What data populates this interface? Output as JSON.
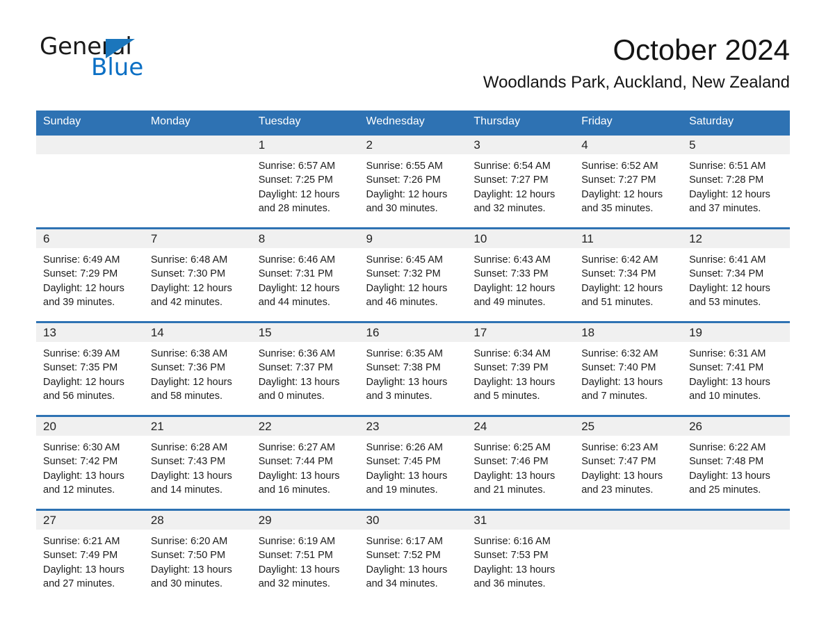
{
  "brand": {
    "name_part1": "General",
    "name_part2": "Blue",
    "triangle_icon": "triangle-logo-icon",
    "accent_color": "#1b76bc"
  },
  "header": {
    "month_title": "October 2024",
    "location": "Woodlands Park, Auckland, New Zealand"
  },
  "theme": {
    "header_blue": "#2e72b3",
    "daynum_band_gray": "#f0f0f0",
    "cell_background": "#ffffff",
    "text_color": "#1c1c1c"
  },
  "calendar": {
    "weekday_headers": [
      "Sunday",
      "Monday",
      "Tuesday",
      "Wednesday",
      "Thursday",
      "Friday",
      "Saturday"
    ],
    "weeks": [
      [
        {
          "day": "",
          "empty": true
        },
        {
          "day": "",
          "empty": true
        },
        {
          "day": "1",
          "sunrise": "Sunrise: 6:57 AM",
          "sunset": "Sunset: 7:25 PM",
          "daylight_line1": "Daylight: 12 hours",
          "daylight_line2": "and 28 minutes."
        },
        {
          "day": "2",
          "sunrise": "Sunrise: 6:55 AM",
          "sunset": "Sunset: 7:26 PM",
          "daylight_line1": "Daylight: 12 hours",
          "daylight_line2": "and 30 minutes."
        },
        {
          "day": "3",
          "sunrise": "Sunrise: 6:54 AM",
          "sunset": "Sunset: 7:27 PM",
          "daylight_line1": "Daylight: 12 hours",
          "daylight_line2": "and 32 minutes."
        },
        {
          "day": "4",
          "sunrise": "Sunrise: 6:52 AM",
          "sunset": "Sunset: 7:27 PM",
          "daylight_line1": "Daylight: 12 hours",
          "daylight_line2": "and 35 minutes."
        },
        {
          "day": "5",
          "sunrise": "Sunrise: 6:51 AM",
          "sunset": "Sunset: 7:28 PM",
          "daylight_line1": "Daylight: 12 hours",
          "daylight_line2": "and 37 minutes."
        }
      ],
      [
        {
          "day": "6",
          "sunrise": "Sunrise: 6:49 AM",
          "sunset": "Sunset: 7:29 PM",
          "daylight_line1": "Daylight: 12 hours",
          "daylight_line2": "and 39 minutes."
        },
        {
          "day": "7",
          "sunrise": "Sunrise: 6:48 AM",
          "sunset": "Sunset: 7:30 PM",
          "daylight_line1": "Daylight: 12 hours",
          "daylight_line2": "and 42 minutes."
        },
        {
          "day": "8",
          "sunrise": "Sunrise: 6:46 AM",
          "sunset": "Sunset: 7:31 PM",
          "daylight_line1": "Daylight: 12 hours",
          "daylight_line2": "and 44 minutes."
        },
        {
          "day": "9",
          "sunrise": "Sunrise: 6:45 AM",
          "sunset": "Sunset: 7:32 PM",
          "daylight_line1": "Daylight: 12 hours",
          "daylight_line2": "and 46 minutes."
        },
        {
          "day": "10",
          "sunrise": "Sunrise: 6:43 AM",
          "sunset": "Sunset: 7:33 PM",
          "daylight_line1": "Daylight: 12 hours",
          "daylight_line2": "and 49 minutes."
        },
        {
          "day": "11",
          "sunrise": "Sunrise: 6:42 AM",
          "sunset": "Sunset: 7:34 PM",
          "daylight_line1": "Daylight: 12 hours",
          "daylight_line2": "and 51 minutes."
        },
        {
          "day": "12",
          "sunrise": "Sunrise: 6:41 AM",
          "sunset": "Sunset: 7:34 PM",
          "daylight_line1": "Daylight: 12 hours",
          "daylight_line2": "and 53 minutes."
        }
      ],
      [
        {
          "day": "13",
          "sunrise": "Sunrise: 6:39 AM",
          "sunset": "Sunset: 7:35 PM",
          "daylight_line1": "Daylight: 12 hours",
          "daylight_line2": "and 56 minutes."
        },
        {
          "day": "14",
          "sunrise": "Sunrise: 6:38 AM",
          "sunset": "Sunset: 7:36 PM",
          "daylight_line1": "Daylight: 12 hours",
          "daylight_line2": "and 58 minutes."
        },
        {
          "day": "15",
          "sunrise": "Sunrise: 6:36 AM",
          "sunset": "Sunset: 7:37 PM",
          "daylight_line1": "Daylight: 13 hours",
          "daylight_line2": "and 0 minutes."
        },
        {
          "day": "16",
          "sunrise": "Sunrise: 6:35 AM",
          "sunset": "Sunset: 7:38 PM",
          "daylight_line1": "Daylight: 13 hours",
          "daylight_line2": "and 3 minutes."
        },
        {
          "day": "17",
          "sunrise": "Sunrise: 6:34 AM",
          "sunset": "Sunset: 7:39 PM",
          "daylight_line1": "Daylight: 13 hours",
          "daylight_line2": "and 5 minutes."
        },
        {
          "day": "18",
          "sunrise": "Sunrise: 6:32 AM",
          "sunset": "Sunset: 7:40 PM",
          "daylight_line1": "Daylight: 13 hours",
          "daylight_line2": "and 7 minutes."
        },
        {
          "day": "19",
          "sunrise": "Sunrise: 6:31 AM",
          "sunset": "Sunset: 7:41 PM",
          "daylight_line1": "Daylight: 13 hours",
          "daylight_line2": "and 10 minutes."
        }
      ],
      [
        {
          "day": "20",
          "sunrise": "Sunrise: 6:30 AM",
          "sunset": "Sunset: 7:42 PM",
          "daylight_line1": "Daylight: 13 hours",
          "daylight_line2": "and 12 minutes."
        },
        {
          "day": "21",
          "sunrise": "Sunrise: 6:28 AM",
          "sunset": "Sunset: 7:43 PM",
          "daylight_line1": "Daylight: 13 hours",
          "daylight_line2": "and 14 minutes."
        },
        {
          "day": "22",
          "sunrise": "Sunrise: 6:27 AM",
          "sunset": "Sunset: 7:44 PM",
          "daylight_line1": "Daylight: 13 hours",
          "daylight_line2": "and 16 minutes."
        },
        {
          "day": "23",
          "sunrise": "Sunrise: 6:26 AM",
          "sunset": "Sunset: 7:45 PM",
          "daylight_line1": "Daylight: 13 hours",
          "daylight_line2": "and 19 minutes."
        },
        {
          "day": "24",
          "sunrise": "Sunrise: 6:25 AM",
          "sunset": "Sunset: 7:46 PM",
          "daylight_line1": "Daylight: 13 hours",
          "daylight_line2": "and 21 minutes."
        },
        {
          "day": "25",
          "sunrise": "Sunrise: 6:23 AM",
          "sunset": "Sunset: 7:47 PM",
          "daylight_line1": "Daylight: 13 hours",
          "daylight_line2": "and 23 minutes."
        },
        {
          "day": "26",
          "sunrise": "Sunrise: 6:22 AM",
          "sunset": "Sunset: 7:48 PM",
          "daylight_line1": "Daylight: 13 hours",
          "daylight_line2": "and 25 minutes."
        }
      ],
      [
        {
          "day": "27",
          "sunrise": "Sunrise: 6:21 AM",
          "sunset": "Sunset: 7:49 PM",
          "daylight_line1": "Daylight: 13 hours",
          "daylight_line2": "and 27 minutes."
        },
        {
          "day": "28",
          "sunrise": "Sunrise: 6:20 AM",
          "sunset": "Sunset: 7:50 PM",
          "daylight_line1": "Daylight: 13 hours",
          "daylight_line2": "and 30 minutes."
        },
        {
          "day": "29",
          "sunrise": "Sunrise: 6:19 AM",
          "sunset": "Sunset: 7:51 PM",
          "daylight_line1": "Daylight: 13 hours",
          "daylight_line2": "and 32 minutes."
        },
        {
          "day": "30",
          "sunrise": "Sunrise: 6:17 AM",
          "sunset": "Sunset: 7:52 PM",
          "daylight_line1": "Daylight: 13 hours",
          "daylight_line2": "and 34 minutes."
        },
        {
          "day": "31",
          "sunrise": "Sunrise: 6:16 AM",
          "sunset": "Sunset: 7:53 PM",
          "daylight_line1": "Daylight: 13 hours",
          "daylight_line2": "and 36 minutes."
        },
        {
          "day": "",
          "empty": true
        },
        {
          "day": "",
          "empty": true
        }
      ]
    ]
  }
}
